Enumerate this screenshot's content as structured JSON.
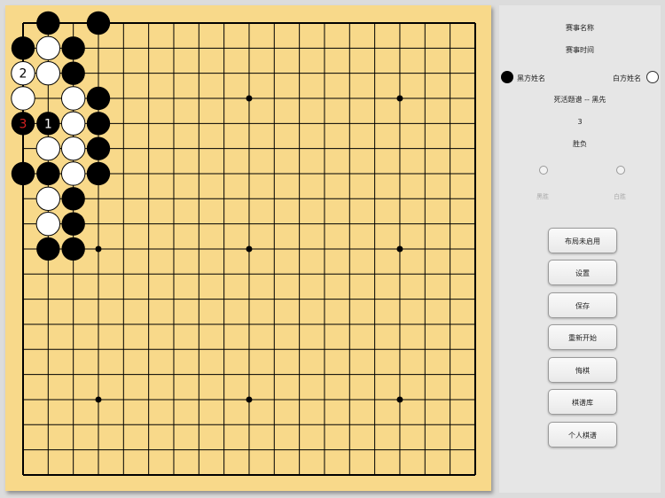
{
  "board": {
    "size": 19,
    "stones": [
      {
        "col": 1,
        "row": 0,
        "color": "black"
      },
      {
        "col": 3,
        "row": 0,
        "color": "black"
      },
      {
        "col": 0,
        "row": 1,
        "color": "black"
      },
      {
        "col": 1,
        "row": 1,
        "color": "white"
      },
      {
        "col": 2,
        "row": 1,
        "color": "black"
      },
      {
        "col": 0,
        "row": 2,
        "color": "white",
        "label": "2"
      },
      {
        "col": 1,
        "row": 2,
        "color": "white"
      },
      {
        "col": 2,
        "row": 2,
        "color": "black"
      },
      {
        "col": 0,
        "row": 3,
        "color": "white"
      },
      {
        "col": 2,
        "row": 3,
        "color": "white"
      },
      {
        "col": 3,
        "row": 3,
        "color": "black"
      },
      {
        "col": 0,
        "row": 4,
        "color": "black",
        "label": "3",
        "label_color": "#d62020"
      },
      {
        "col": 1,
        "row": 4,
        "color": "black",
        "label": "1"
      },
      {
        "col": 2,
        "row": 4,
        "color": "white"
      },
      {
        "col": 3,
        "row": 4,
        "color": "black"
      },
      {
        "col": 1,
        "row": 5,
        "color": "white"
      },
      {
        "col": 2,
        "row": 5,
        "color": "white"
      },
      {
        "col": 3,
        "row": 5,
        "color": "black"
      },
      {
        "col": 0,
        "row": 6,
        "color": "black"
      },
      {
        "col": 1,
        "row": 6,
        "color": "black"
      },
      {
        "col": 2,
        "row": 6,
        "color": "white"
      },
      {
        "col": 3,
        "row": 6,
        "color": "black"
      },
      {
        "col": 1,
        "row": 7,
        "color": "white"
      },
      {
        "col": 2,
        "row": 7,
        "color": "black"
      },
      {
        "col": 1,
        "row": 8,
        "color": "white"
      },
      {
        "col": 2,
        "row": 8,
        "color": "black"
      },
      {
        "col": 1,
        "row": 9,
        "color": "black"
      },
      {
        "col": 2,
        "row": 9,
        "color": "black"
      }
    ],
    "star_points": [
      [
        3,
        3
      ],
      [
        9,
        3
      ],
      [
        15,
        3
      ],
      [
        3,
        9
      ],
      [
        9,
        9
      ],
      [
        15,
        9
      ],
      [
        3,
        15
      ],
      [
        9,
        15
      ],
      [
        15,
        15
      ]
    ],
    "colors": {
      "board": "#f8d98a",
      "line": "#000000",
      "black": "#000000",
      "white": "#ffffff"
    }
  },
  "panel": {
    "event_name": "赛事名称",
    "event_time": "赛事时间",
    "black_player": "黑方姓名",
    "white_player": "白方姓名",
    "problem_title": "死活题谱 -- 黑先",
    "move_count": "3",
    "result": "胜负",
    "radio_black": "黑胜",
    "radio_white": "白胜",
    "buttons": [
      "布局未启用",
      "设置",
      "保存",
      "重新开始",
      "悔棋",
      "棋谱库",
      "个人棋谱"
    ]
  }
}
